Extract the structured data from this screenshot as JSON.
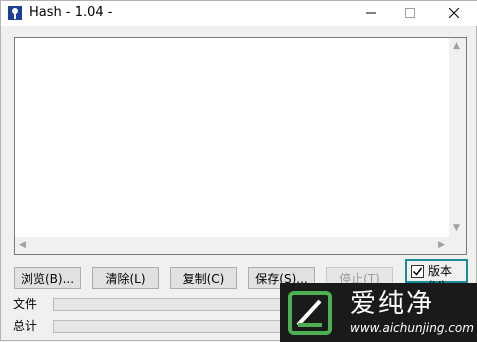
{
  "window": {
    "title": "Hash - 1.04 -"
  },
  "controls": {
    "minimize_icon": "minimize-icon",
    "maximize_icon": "maximize-icon",
    "close_icon": "close-icon"
  },
  "output": {
    "text": ""
  },
  "buttons": {
    "browse": "浏览(B)...",
    "clear": "清除(L)",
    "copy": "复制(C)",
    "save": "保存(S)...",
    "stop": "停止(T)"
  },
  "options": {
    "version_label": "版本(V)",
    "version_checked": true
  },
  "progress": {
    "file_label": "文件",
    "file_value": 0,
    "total_label": "总计",
    "total_value": 0
  },
  "watermark": {
    "text": "爱纯净",
    "url": "www.aichunjing.com"
  },
  "colors": {
    "accent": "#1b8b98",
    "window_bg": "#f0f0f0",
    "watermark_bg": "#1a1a1a",
    "watermark_logo": "#4caf50"
  }
}
